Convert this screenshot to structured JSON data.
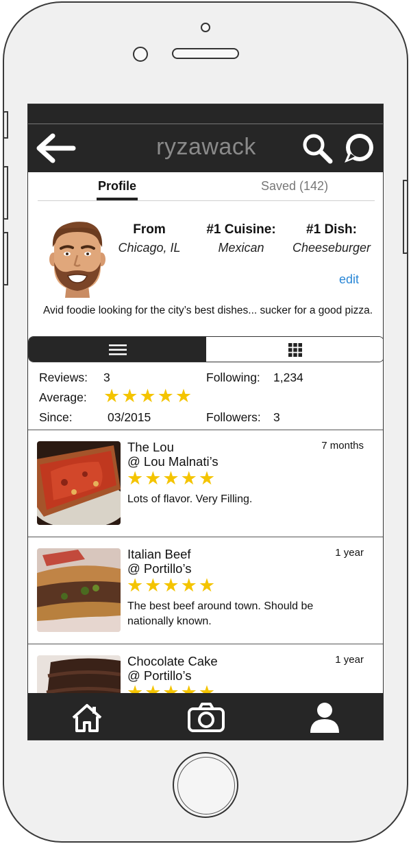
{
  "header": {
    "title": "ryzawack"
  },
  "tabs": {
    "profile": "Profile",
    "saved": "Saved (142)"
  },
  "profile": {
    "from_label": "From",
    "from_value": "Chicago, IL",
    "cuisine_label": "#1 Cuisine:",
    "cuisine_value": "Mexican",
    "dish_label": "#1 Dish:",
    "dish_value": "Cheeseburger",
    "edit_label": "edit",
    "bio": "Avid foodie looking for the city’s best dishes... sucker for a good pizza."
  },
  "stats": {
    "reviews_label": "Reviews:",
    "reviews_value": "3",
    "average_label": "Average:",
    "average_stars": "★★★★★",
    "since_label": "Since:",
    "since_value": "03/2015",
    "following_label": "Following:",
    "following_value": "1,234",
    "followers_label": "Followers:",
    "followers_value": "3"
  },
  "reviews": [
    {
      "dish": "The Lou",
      "venue": "@ Lou Malnati’s",
      "stars": "★★★★★",
      "text": "Lots of flavor. Very Filling.",
      "age": "7 months"
    },
    {
      "dish": "Italian Beef",
      "venue": "@ Portillo’s",
      "stars": "★★★★★",
      "text": "The best beef around town. Should be nationally known.",
      "age": "1 year"
    },
    {
      "dish": "Chocolate Cake",
      "venue": "@ Portillo’s",
      "stars": "★★★★★",
      "text": "",
      "age": "1 year"
    }
  ],
  "colors": {
    "dark_bar": "#262626",
    "star": "#f4c400",
    "link": "#2a87d6",
    "frame": "#f0f0f0"
  },
  "icons": [
    "back-arrow-icon",
    "search-icon",
    "chat-bubble-icon",
    "list-view-icon",
    "grid-view-icon",
    "home-icon",
    "camera-icon",
    "profile-icon"
  ]
}
